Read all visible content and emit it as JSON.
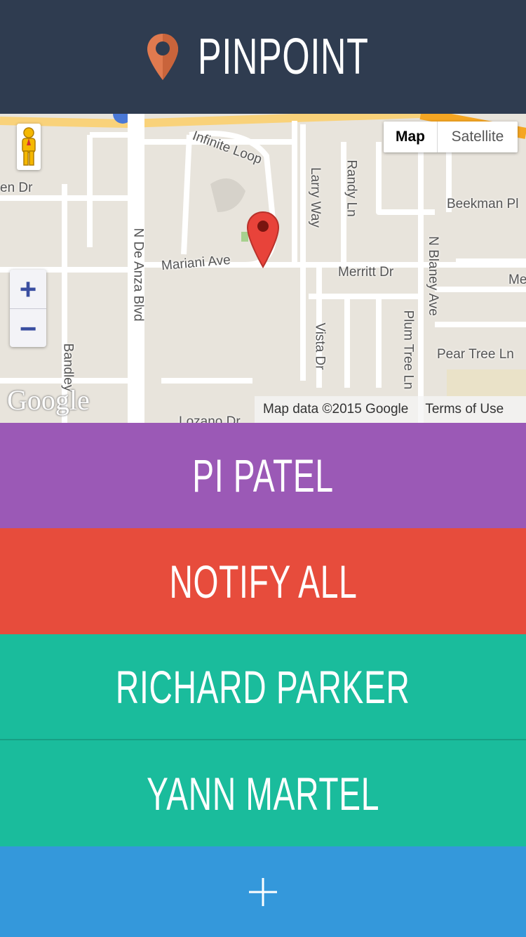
{
  "app": {
    "title": "PINPOINT",
    "brand_color": "#2f3c50",
    "logo_icon": "map-pin-icon"
  },
  "map": {
    "map_type_options": [
      "Map",
      "Satellite"
    ],
    "selected_map_type": "Map",
    "zoom_in_label": "+",
    "zoom_out_label": "−",
    "logo_text": "Google",
    "attribution": "Map data ©2015 Google",
    "terms_label": "Terms of Use",
    "street_labels": {
      "infinite_loop": "Infinite Loop",
      "larry_way": "Larry Way",
      "randy_ln": "Randy Ln",
      "beekman_pl": "Beekman Pl",
      "en_dr": "en Dr",
      "n_de_anza_blvd": "N De Anza Blvd",
      "mariani_ave": "Mariani Ave",
      "merritt_dr": "Merritt Dr",
      "n_blaney_ave": "N Blaney Ave",
      "me": "Me",
      "vista_dr": "Vista Dr",
      "plum_tree_ln": "Plum Tree Ln",
      "pear_tree_ln": "Pear Tree Ln",
      "bandley": "Bandley",
      "lozano_dr": "Lozano Dr"
    }
  },
  "contacts": [
    {
      "label": "PI PATEL",
      "color": "#9b59b6"
    },
    {
      "label": "NOTIFY ALL",
      "color": "#e74c3c"
    },
    {
      "label": "RICHARD PARKER",
      "color": "#1abc9c"
    },
    {
      "label": "YANN MARTEL",
      "color": "#1abc9c"
    }
  ],
  "add_button": {
    "icon": "plus-icon",
    "color": "#3498db"
  }
}
